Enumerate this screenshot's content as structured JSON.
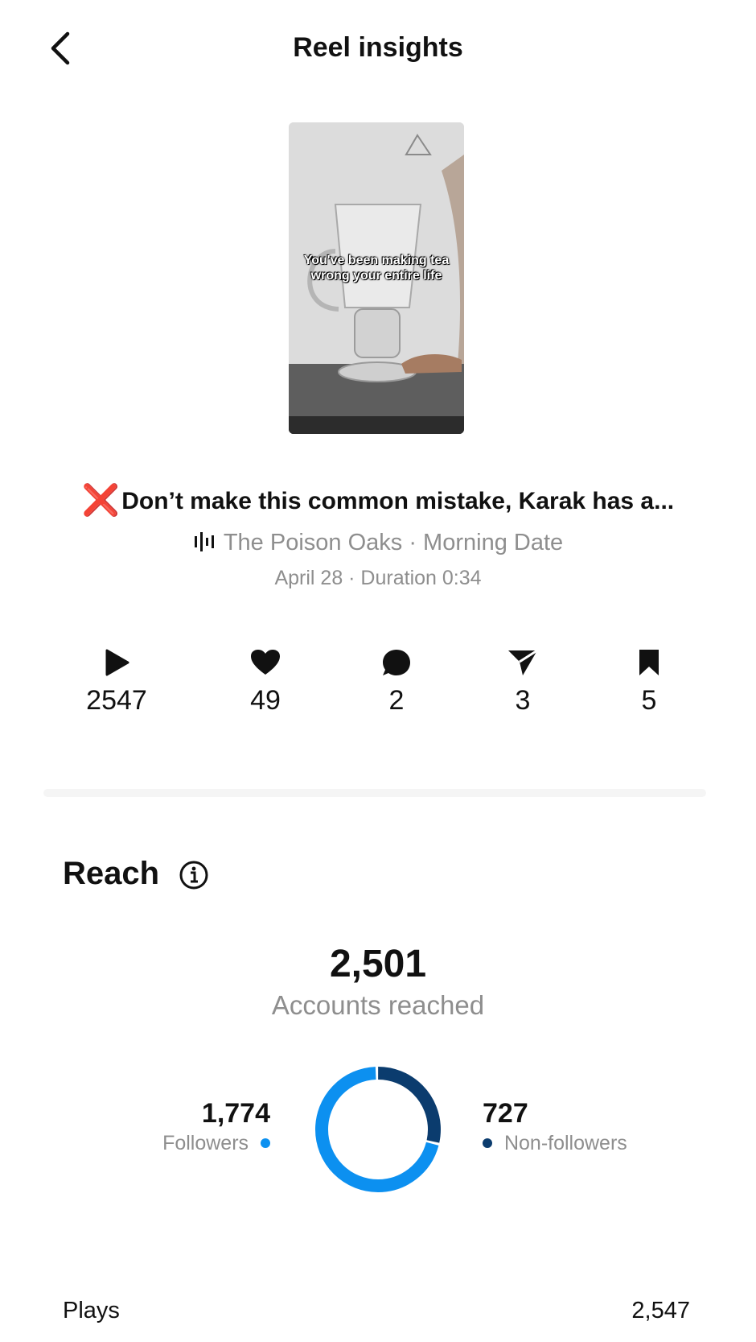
{
  "header": {
    "title": "Reel insights"
  },
  "reel": {
    "thumbnail_caption": "You've been making tea wrong your entire life",
    "caption": "Don’t make this common mistake, Karak has a...",
    "caption_emoji": "❌",
    "audio": "The Poison Oaks · Morning Date",
    "meta": "April 28 · Duration 0:34"
  },
  "stats": {
    "plays": "2547",
    "likes": "49",
    "comments": "2",
    "shares": "3",
    "saves": "5"
  },
  "reach": {
    "title": "Reach",
    "accounts_reached": "2,501",
    "accounts_reached_label": "Accounts reached",
    "followers": {
      "value": "1,774",
      "label": "Followers",
      "color": "#0c90f0",
      "share": 0.709
    },
    "non_followers": {
      "value": "727",
      "label": "Non-followers",
      "color": "#0b3c6e",
      "share": 0.291
    }
  },
  "plays_row": {
    "label": "Plays",
    "value": "2,547"
  }
}
